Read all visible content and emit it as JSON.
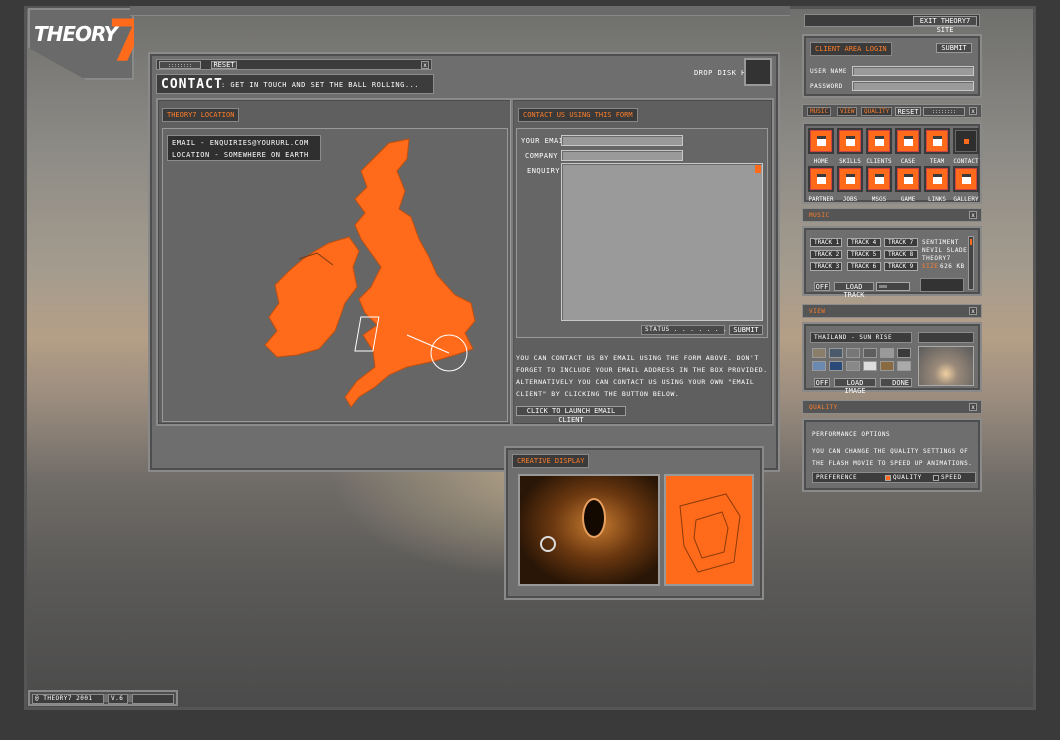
{
  "logo": {
    "text": "THEORY"
  },
  "top_bar": {
    "exit_label": "EXIT THEORY7 SITE"
  },
  "contact_window": {
    "title_bar": {
      "reset_label": "RESET",
      "close_label": "x"
    },
    "heading": {
      "title": "CONTACT",
      "subtitle": ": GET IN TOUCH AND SET THE BALL ROLLING..."
    },
    "drop_disk_label": "DROP DISK HERE",
    "location": {
      "tab": "THEORY7 LOCATION",
      "email": "EMAIL - ENQUIRIES@YOURURL.COM",
      "place": "LOCATION - SOMEWHERE ON EARTH"
    },
    "form": {
      "tab": "CONTACT US USING THIS FORM",
      "email_label": "YOUR EMAIL",
      "company_label": "COMPANY",
      "enquiry_label": "ENQUIRY",
      "status_label": "STATUS . . . . . . . . . .",
      "submit_label": "SUBMIT",
      "info_text": "YOU CAN CONTACT US BY EMAIL USING THE FORM ABOVE.  DON'T FORGET TO INCLUDE YOUR EMAIL ADDRESS IN THE BOX PROVIDED. ALTERNATIVELY YOU CAN CONTACT US USING YOUR OWN \"EMAIL CLIENT\" BY CLICKING THE BUTTON BELOW.",
      "launch_label": "CLICK TO LAUNCH EMAIL CLIENT"
    }
  },
  "creative_display": {
    "tab": "CREATIVE DISPLAY"
  },
  "login": {
    "title": "CLIENT AREA LOGIN",
    "submit_label": "SUBMIT",
    "username_label": "USER NAME",
    "password_label": "PASSWORD"
  },
  "toolbar": {
    "tabs": [
      "MUSIC",
      "VIEW",
      "QUALITY"
    ],
    "reset_label": "RESET",
    "close_label": "x"
  },
  "nav": {
    "row1": [
      "HOME",
      "SKILLS",
      "CLIENTS",
      "CASE",
      "TEAM",
      "CONTACT"
    ],
    "row2": [
      "PARTNER",
      "JOBS",
      "MSGS",
      "GAME",
      "LINKS",
      "GALLERY"
    ]
  },
  "music": {
    "header": "MUSIC",
    "tracks": [
      "TRACK 1",
      "TRACK 2",
      "TRACK 3",
      "TRACK 4",
      "TRACK 5",
      "TRACK 6",
      "TRACK 7",
      "TRACK 8",
      "TRACK 9"
    ],
    "info_line1": "SENTIMENT",
    "info_line2": "NEVIL SLADE",
    "info_line3": "THEORY7",
    "size_label": "SIZE",
    "size_value": "626 KB",
    "off_label": "OFF",
    "load_label": "LOAD TRACK"
  },
  "view": {
    "header": "VIEW",
    "caption": "THAILAND - SUN RISE",
    "off_label": "OFF",
    "load_label": "LOAD IMAGE",
    "done_label": "DONE"
  },
  "quality": {
    "header": "QUALITY",
    "title": "PERFORMANCE OPTIONS",
    "description": "YOU CAN CHANGE THE QUALITY SETTINGS OF THE FLASH MOVIE TO SPEED UP ANIMATIONS.",
    "preference_label": "PREFERENCE",
    "quality_label": "QUALITY",
    "speed_label": "SPEED"
  },
  "footer": {
    "copyright": "@ THEORY7 2001",
    "version": "V.6"
  },
  "colors": {
    "accent": "#ff6b1a",
    "panel": "#6e6e6e"
  }
}
